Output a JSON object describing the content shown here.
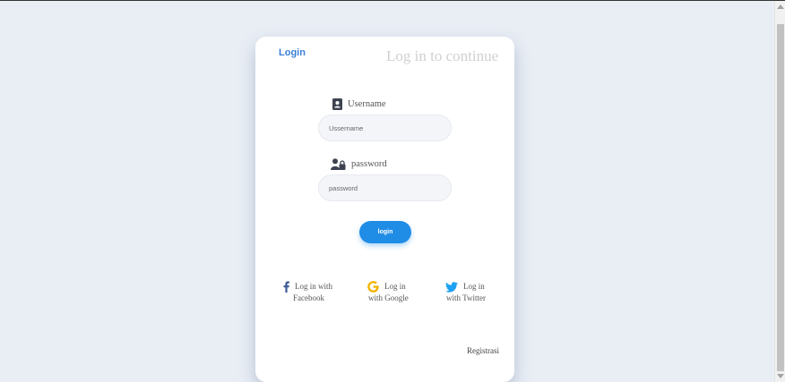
{
  "card": {
    "tab_login": "Login",
    "heading": "Log in to continue",
    "username_label": "Username",
    "username_placeholder": "Ussername",
    "password_label": "password",
    "password_placeholder": "password",
    "login_button": "login",
    "social": {
      "facebook": {
        "line1": "Log in with",
        "line2": "Facebook",
        "icon": "facebook-icon",
        "color": "#3b5998"
      },
      "google": {
        "line1": "Log in",
        "line2": "with Google",
        "icon": "google-icon",
        "color": "#f4b400"
      },
      "twitter": {
        "line1": "Log in",
        "line2": "with Twitter",
        "icon": "twitter-icon",
        "color": "#1da1f2"
      }
    },
    "register_link": "Registrasi"
  },
  "colors": {
    "page_bg": "#e9eef5",
    "accent": "#1f8ce6",
    "tab_blue": "#3a7fd5",
    "heading_gray": "#d0d0d0"
  }
}
